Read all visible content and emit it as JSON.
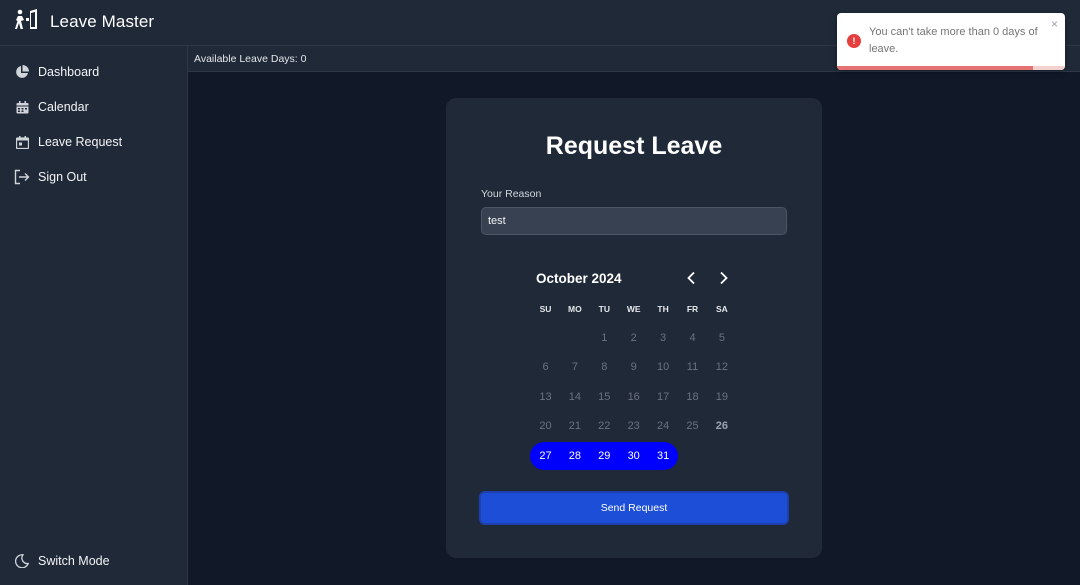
{
  "app": {
    "title": "Leave Master"
  },
  "sidebar": {
    "items": [
      {
        "label": "Dashboard",
        "icon": "pie-chart-icon"
      },
      {
        "label": "Calendar",
        "icon": "calendar-icon"
      },
      {
        "label": "Leave Request",
        "icon": "calendar-check-icon"
      },
      {
        "label": "Sign Out",
        "icon": "sign-out-icon"
      }
    ],
    "footer": {
      "label": "Switch Mode",
      "icon": "moon-icon"
    }
  },
  "subbar": {
    "text": "Available Leave Days: 0"
  },
  "form": {
    "title": "Request Leave",
    "reason_label": "Your Reason",
    "reason_value": "test",
    "submit_label": "Send Request"
  },
  "calendar": {
    "month_label": "October 2024",
    "weekdays": [
      "SU",
      "MO",
      "TU",
      "WE",
      "TH",
      "FR",
      "SA"
    ],
    "first_weekday_index": 2,
    "days_in_month": 31,
    "today": 26,
    "selected_range": [
      27,
      31
    ],
    "selection_color": "#0000ff"
  },
  "toast": {
    "message": "You can't take more than 0 days of leave.",
    "type": "error",
    "icon": "error-icon",
    "close_label": "×",
    "progress": 0.86,
    "accent_color": "#e53e3e"
  },
  "colors": {
    "background": "#111827",
    "panel": "#1f2937",
    "button": "#1d4ed8"
  }
}
